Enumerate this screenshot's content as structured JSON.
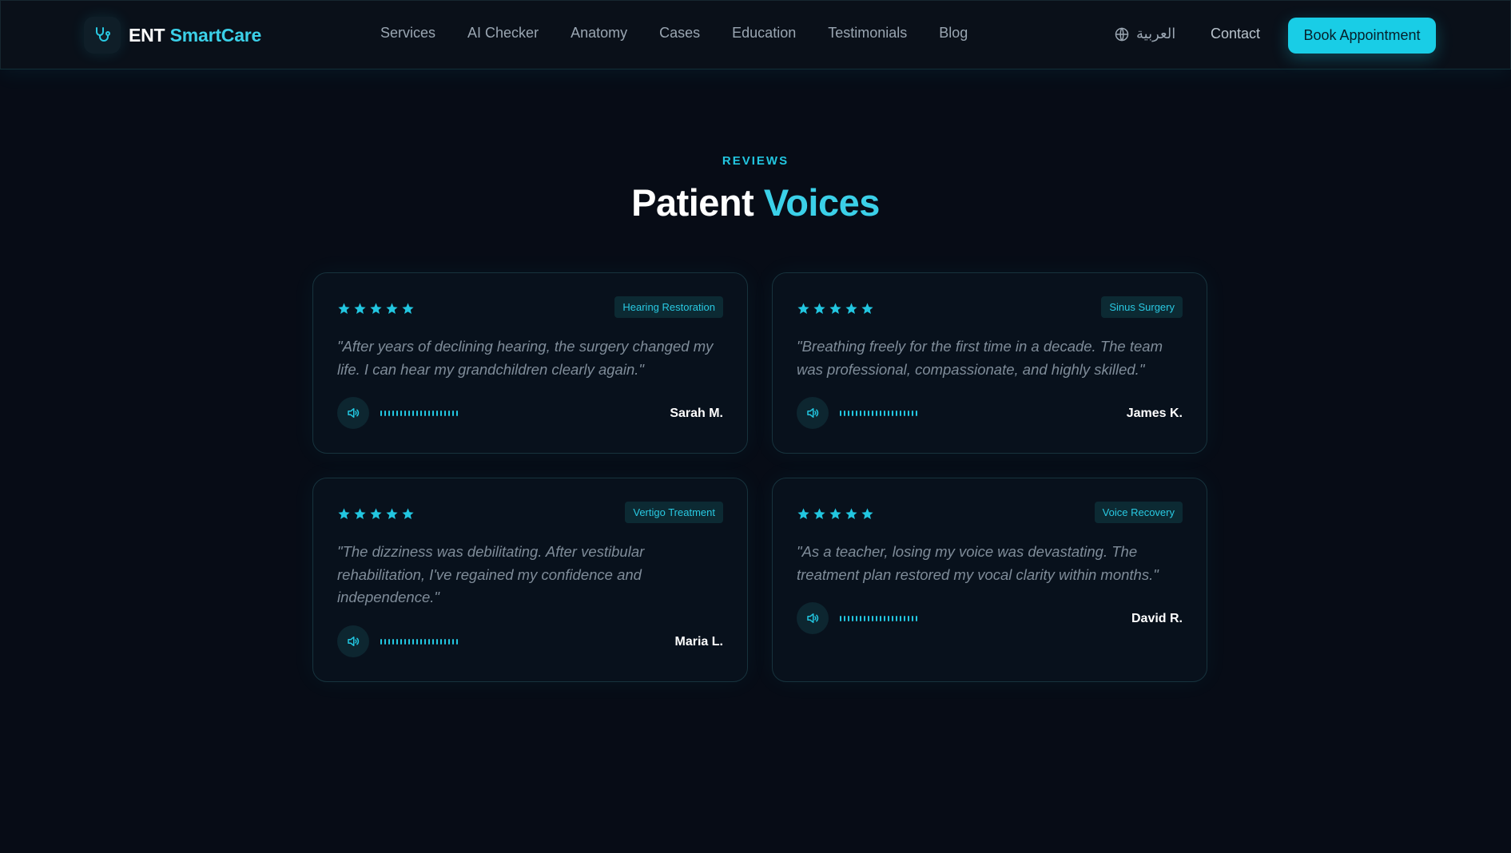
{
  "brand": {
    "ent": "ENT",
    "smartcare": "SmartCare"
  },
  "nav": {
    "links": [
      "Services",
      "AI Checker",
      "Anatomy",
      "Cases",
      "Education",
      "Testimonials",
      "Blog"
    ],
    "language": "العربية",
    "contact": "Contact",
    "cta": "Book Appointment"
  },
  "section": {
    "eyebrow": "REVIEWS",
    "title_a": "Patient",
    "title_b": "Voices"
  },
  "colors": {
    "accent": "#22c6e0",
    "background": "#070c16"
  },
  "reviews": [
    {
      "rating": 5,
      "tag": "Hearing Restoration",
      "quote": "\"After years of declining hearing, the surgery changed my life. I can hear my grandchildren clearly again.\"",
      "name": "Sarah M."
    },
    {
      "rating": 5,
      "tag": "Sinus Surgery",
      "quote": "\"Breathing freely for the first time in a decade. The team was professional, compassionate, and highly skilled.\"",
      "name": "James K."
    },
    {
      "rating": 5,
      "tag": "Vertigo Treatment",
      "quote": "\"The dizziness was debilitating. After vestibular rehabilitation, I've regained my confidence and independence.\"",
      "name": "Maria L."
    },
    {
      "rating": 5,
      "tag": "Voice Recovery",
      "quote": "\"As a teacher, losing my voice was devastating. The treatment plan restored my vocal clarity within months.\"",
      "name": "David R."
    }
  ]
}
